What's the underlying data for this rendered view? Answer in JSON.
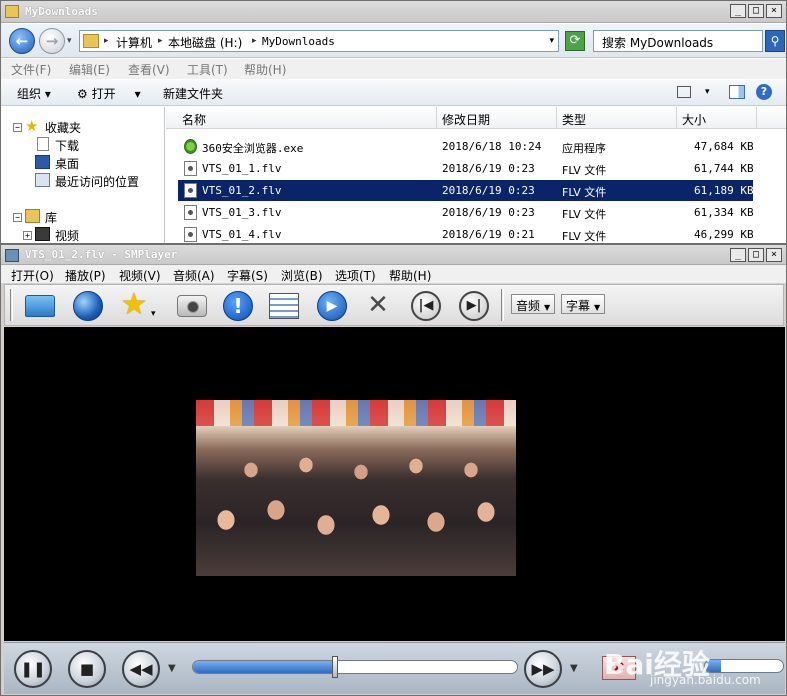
{
  "explorer": {
    "title": "MyDownloads",
    "breadcrumb": [
      "计算机",
      "本地磁盘 (H:)",
      "MyDownloads"
    ],
    "search_placeholder": "搜索 MyDownloads",
    "menu": [
      "文件(F)",
      "编辑(E)",
      "查看(V)",
      "工具(T)",
      "帮助(H)"
    ],
    "toolbar": {
      "organize": "组织",
      "open": "打开",
      "new_folder": "新建文件夹"
    },
    "nav": {
      "favorites": "收藏夹",
      "downloads": "下载",
      "desktop": "桌面",
      "recent": "最近访问的位置",
      "library": "库",
      "video": "视频"
    },
    "columns": [
      "名称",
      "修改日期",
      "类型",
      "大小"
    ],
    "files": [
      {
        "name": "360安全浏览器.exe",
        "date": "2018/6/18 10:24",
        "type": "应用程序",
        "size": "47,684 KB",
        "icon": "exe-icon"
      },
      {
        "name": "VTS_01_1.flv",
        "date": "2018/6/19 0:23",
        "type": "FLV 文件",
        "size": "61,744 KB",
        "icon": "flv-file-icon"
      },
      {
        "name": "VTS_01_2.flv",
        "date": "2018/6/19 0:23",
        "type": "FLV 文件",
        "size": "61,189 KB",
        "icon": "flv-file-icon",
        "selected": true
      },
      {
        "name": "VTS_01_3.flv",
        "date": "2018/6/19 0:23",
        "type": "FLV 文件",
        "size": "61,334 KB",
        "icon": "flv-file-icon"
      },
      {
        "name": "VTS_01_4.flv",
        "date": "2018/6/19 0:21",
        "type": "FLV 文件",
        "size": "46,299 KB",
        "icon": "flv-file-icon"
      }
    ]
  },
  "player": {
    "title": "VTS_01_2.flv - SMPlayer",
    "menu": [
      "打开(O)",
      "播放(P)",
      "视频(V)",
      "音频(A)",
      "字幕(S)",
      "浏览(B)",
      "选项(T)",
      "帮助(H)"
    ],
    "audio_dropdown": "音频",
    "subtitle_dropdown": "字幕",
    "seek_fraction": 0.44,
    "volume_fraction": 0.2
  },
  "watermark": {
    "text": "Bai经验",
    "sub": "jingyan.baidu.com"
  },
  "colors": {
    "selection": "#0a246a",
    "player_bg": "#000000"
  }
}
